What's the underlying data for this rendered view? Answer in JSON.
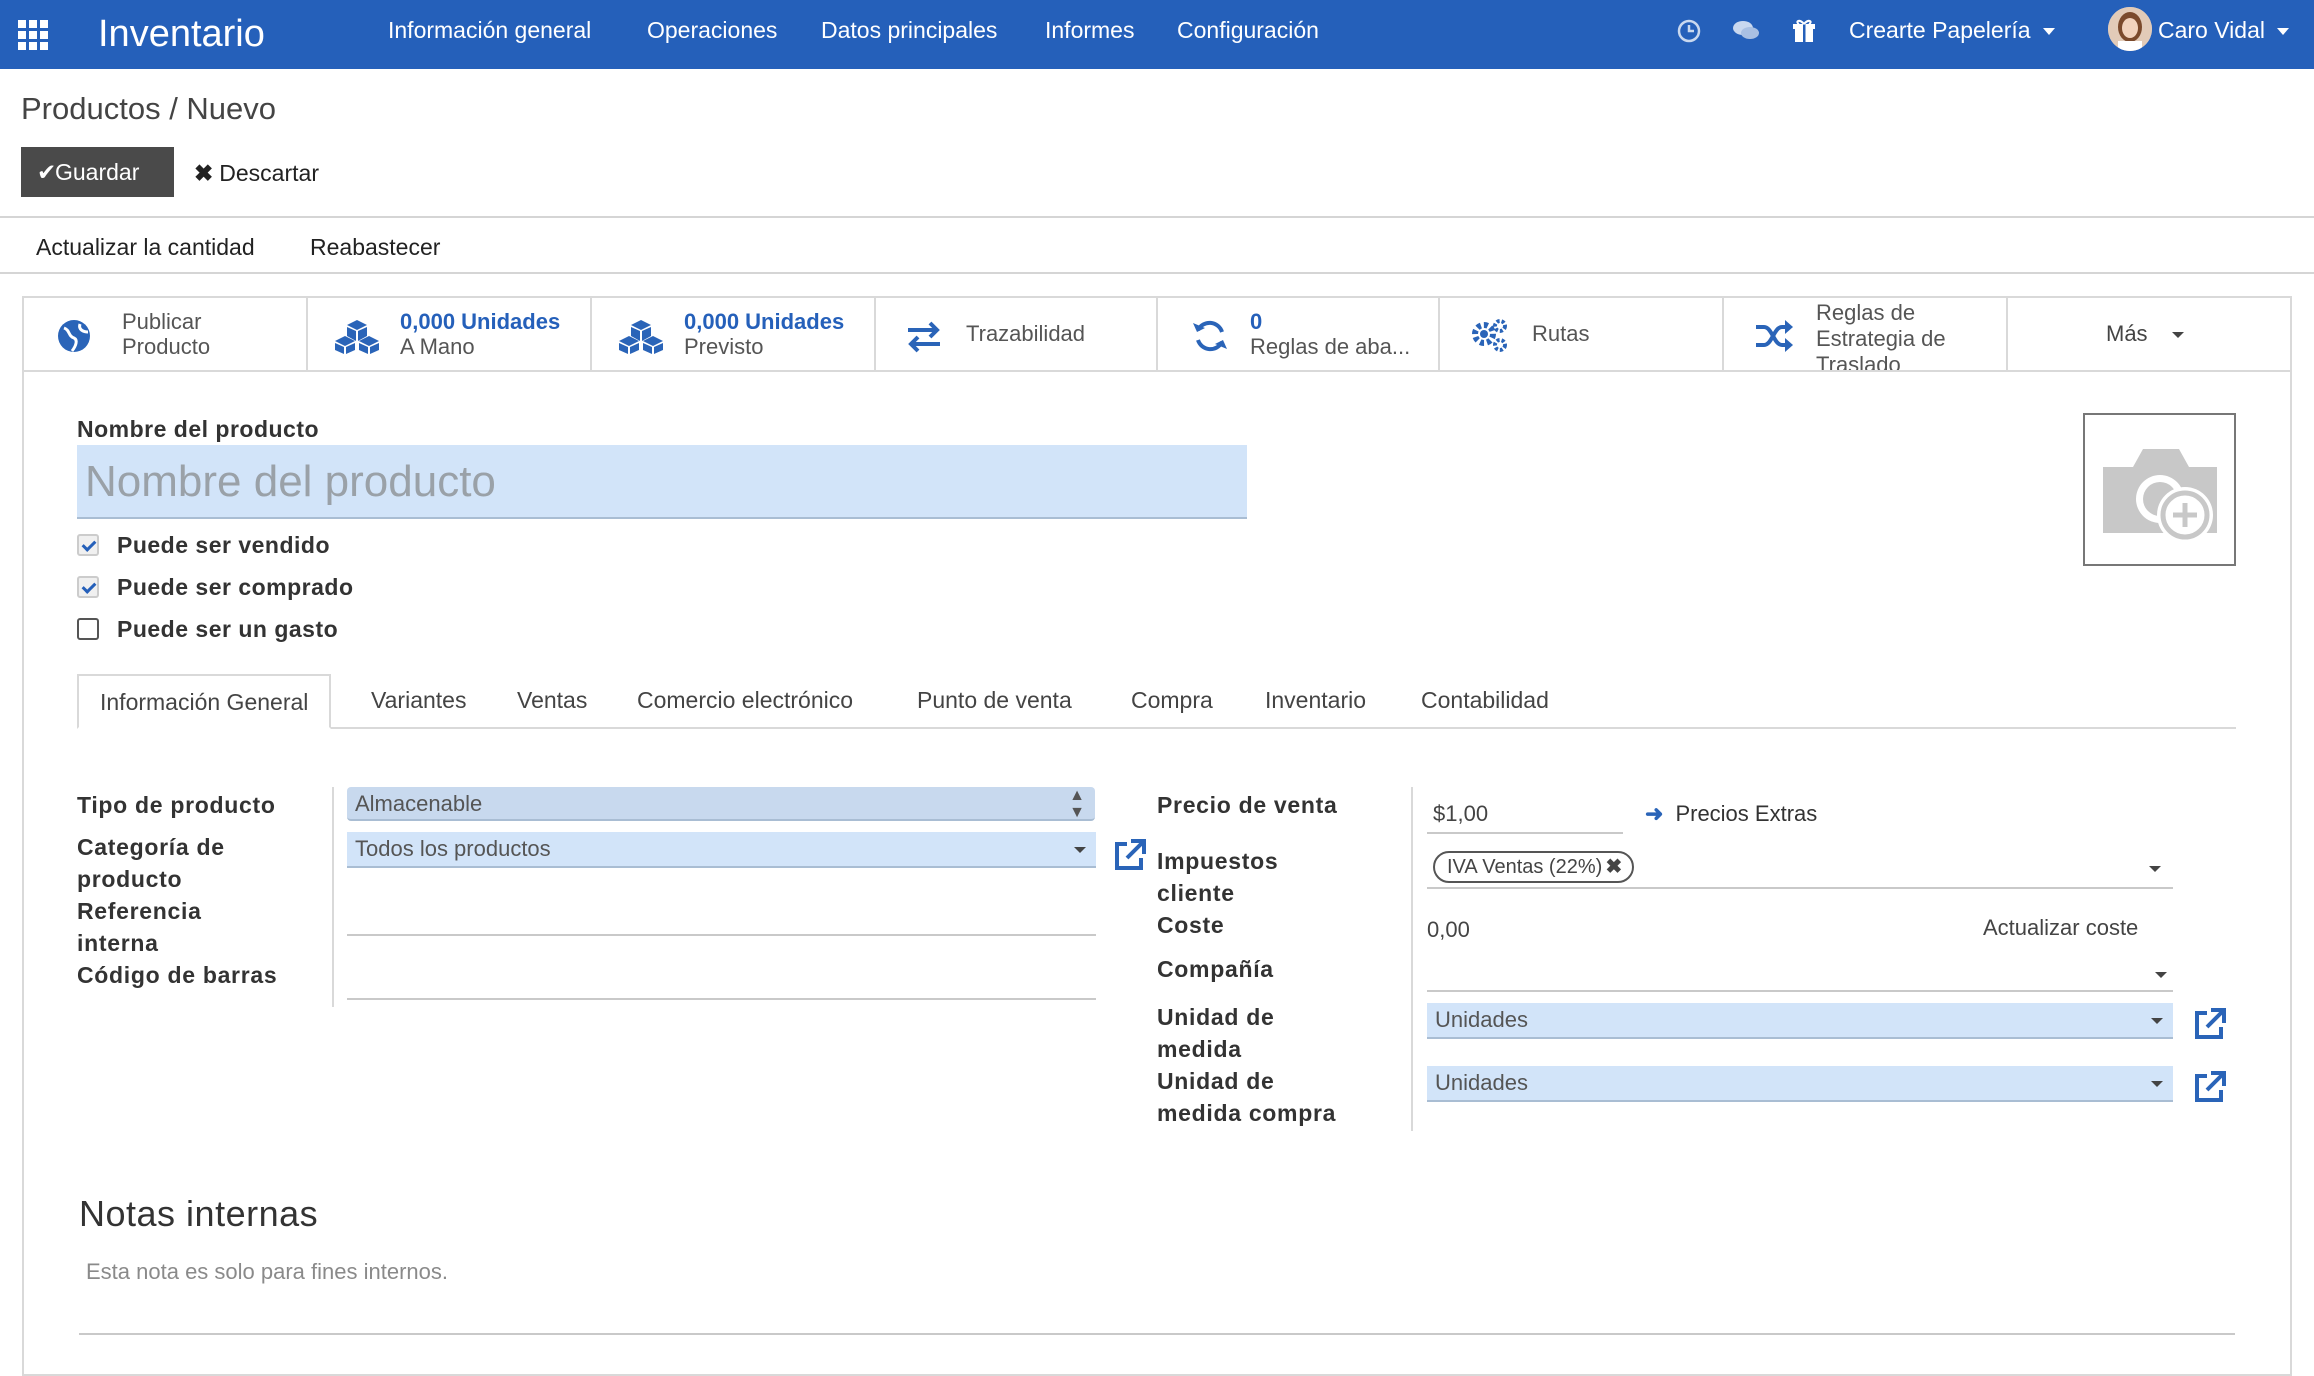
{
  "navbar": {
    "app_name": "Inventario",
    "menu": [
      "Información general",
      "Operaciones",
      "Datos principales",
      "Informes",
      "Configuración"
    ],
    "icons": [
      "clock-icon",
      "chat-icon",
      "gift-icon"
    ],
    "company": "Crearte Papelería",
    "user": "Caro Vidal",
    "color": "#2560ba"
  },
  "breadcrumb": "Productos / Nuevo",
  "buttons": {
    "save": "Guardar",
    "discard": "Descartar"
  },
  "header_buttons": [
    "Actualizar la cantidad",
    "Reabastecer"
  ],
  "smart_buttons": {
    "publish": {
      "line1": "Publicar",
      "line2": "Producto",
      "icon": "globe-icon"
    },
    "on_hand": {
      "value": "0,000 Unidades",
      "label": "A Mano",
      "icon": "cubes-icon"
    },
    "forecast": {
      "value": "0,000 Unidades",
      "label": "Previsto",
      "icon": "cubes-icon"
    },
    "traceability": {
      "label": "Trazabilidad",
      "icon": "exchange-icon"
    },
    "reorder": {
      "value": "0",
      "label": "Reglas de aba...",
      "icon": "refresh-icon"
    },
    "routes": {
      "label": "Rutas",
      "icon": "gears-icon"
    },
    "putaway": {
      "line1": "Reglas de",
      "line2": "Estrategia de",
      "line3": "Traslado",
      "icon": "random-icon"
    },
    "more": "Más"
  },
  "product": {
    "name_label": "Nombre del producto",
    "name_placeholder": "Nombre del producto",
    "checkboxes": [
      {
        "label": "Puede ser vendido",
        "checked": true
      },
      {
        "label": "Puede ser comprado",
        "checked": true
      },
      {
        "label": "Puede ser un gasto",
        "checked": false
      }
    ]
  },
  "tabs": [
    "Información General",
    "Variantes",
    "Ventas",
    "Comercio electrónico",
    "Punto de venta",
    "Compra",
    "Inventario",
    "Contabilidad"
  ],
  "general": {
    "type_label": "Tipo de producto",
    "type_value": "Almacenable",
    "category_label_1": "Categoría de",
    "category_label_2": "producto",
    "category_value": "Todos los productos",
    "ref_label_1": "Referencia",
    "ref_label_2": "interna",
    "barcode_label": "Código de barras",
    "price_label": "Precio de venta",
    "price_value": "$1,00",
    "extra_prices": "Precios Extras",
    "taxes_label_1": "Impuestos",
    "taxes_label_2": "cliente",
    "tax_tag": "IVA Ventas (22%)",
    "cost_label": "Coste",
    "cost_value": "0,00",
    "update_cost": "Actualizar coste",
    "company_label": "Compañía",
    "uom_label_1": "Unidad de",
    "uom_label_2": "medida",
    "uom_value": "Unidades",
    "uom_po_label_1": "Unidad de",
    "uom_po_label_2": "medida compra",
    "uom_po_value": "Unidades"
  },
  "notes": {
    "title": "Notas internas",
    "placeholder": "Esta nota es solo para fines internos."
  }
}
